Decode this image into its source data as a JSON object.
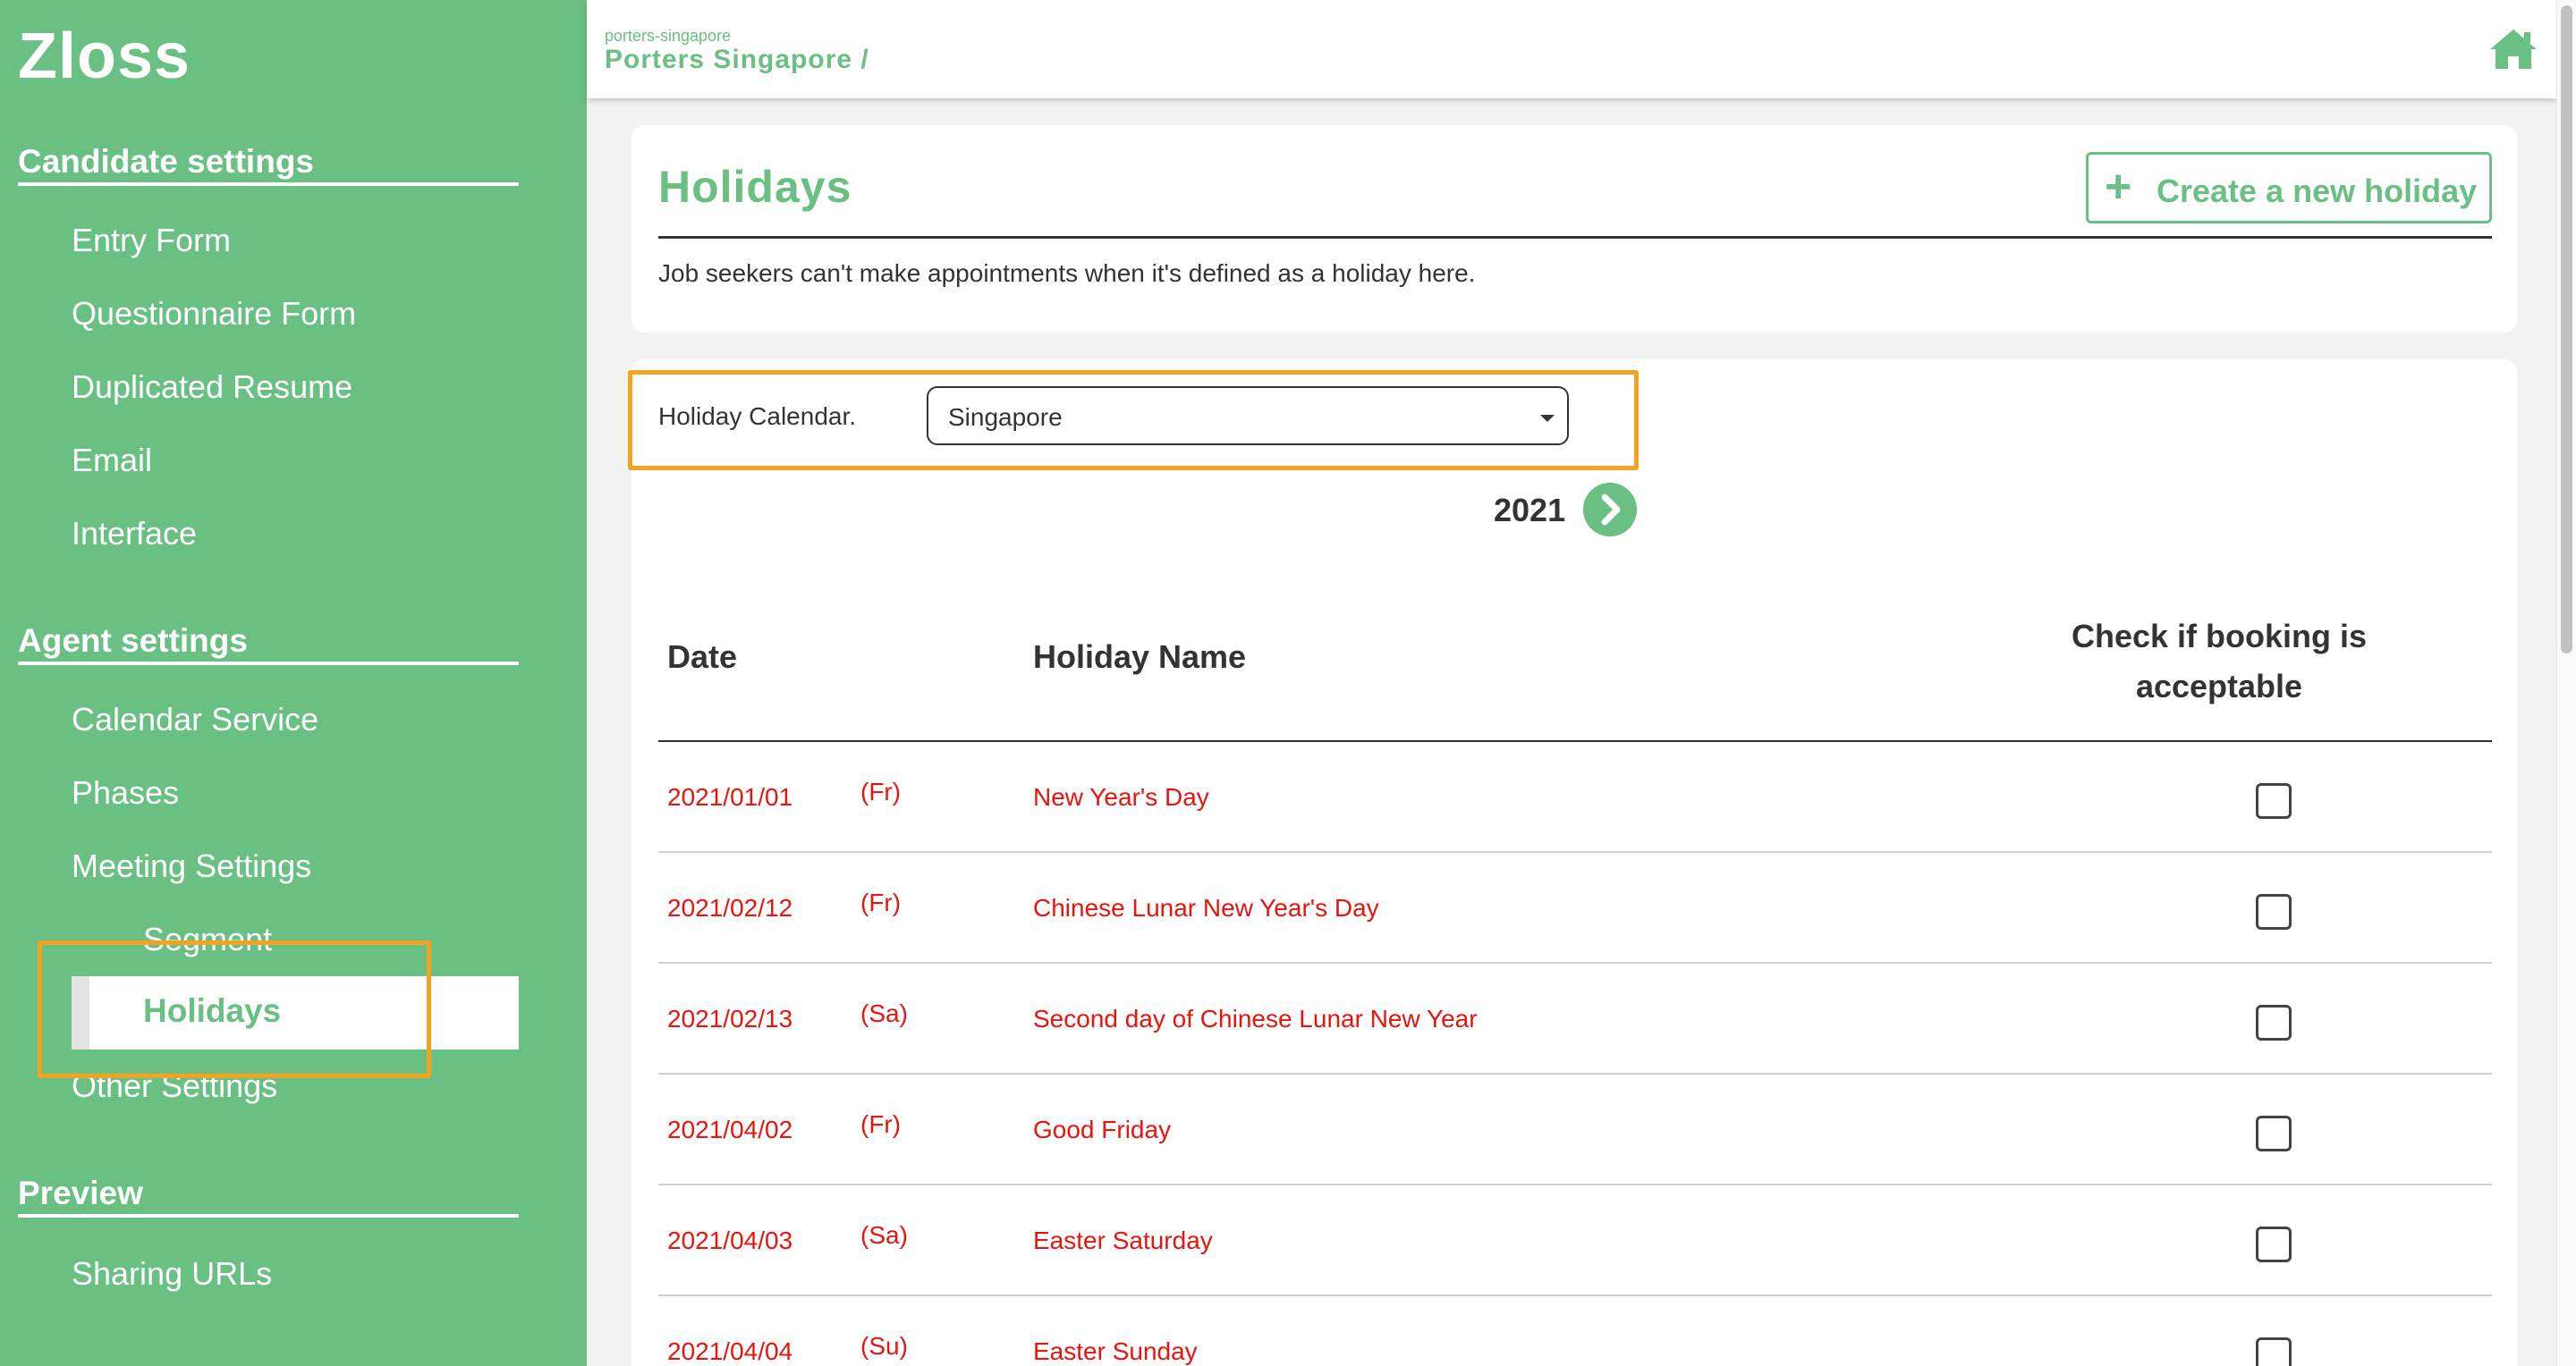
{
  "app": {
    "brand": "Zloss"
  },
  "colors": {
    "accent": "#6abf83",
    "holiday_text": "#e8140e",
    "highlight": "#f4a321"
  },
  "sidebar": {
    "sections": [
      {
        "title": "Candidate settings",
        "items": [
          "Entry Form",
          "Questionnaire Form",
          "Duplicated Resume",
          "Email",
          "Interface"
        ]
      },
      {
        "title": "Agent settings",
        "items": [
          "Calendar Service",
          "Phases",
          "Meeting Settings"
        ],
        "sub_items": [
          "Segment",
          "Holidays"
        ],
        "after_items": [
          "Other Settings"
        ]
      },
      {
        "title": "Preview",
        "items": [
          "Sharing URLs"
        ]
      }
    ],
    "active_item": "Holidays"
  },
  "header": {
    "org_slug": "porters-singapore",
    "org_name": "Porters Singapore /",
    "home_icon": "home-icon"
  },
  "page": {
    "title": "Holidays",
    "create_button": "Create a new holiday",
    "description": "Job seekers can't make appointments when it's defined as a holiday here."
  },
  "filter": {
    "label": "Holiday Calendar.",
    "selected": "Singapore"
  },
  "year": "2021",
  "table": {
    "headers": {
      "date": "Date",
      "name": "Holiday Name",
      "check_line1": "Check if booking is",
      "check_line2": "acceptable"
    },
    "rows": [
      {
        "date": "2021/01/01",
        "day": "(Fr)",
        "name": "New Year's Day",
        "checked": false
      },
      {
        "date": "2021/02/12",
        "day": "(Fr)",
        "name": "Chinese Lunar New Year's Day",
        "checked": false
      },
      {
        "date": "2021/02/13",
        "day": "(Sa)",
        "name": "Second day of Chinese Lunar New Year",
        "checked": false
      },
      {
        "date": "2021/04/02",
        "day": "(Fr)",
        "name": "Good Friday",
        "checked": false
      },
      {
        "date": "2021/04/03",
        "day": "(Sa)",
        "name": "Easter Saturday",
        "checked": false
      },
      {
        "date": "2021/04/04",
        "day": "(Su)",
        "name": "Easter Sunday",
        "checked": false
      }
    ]
  }
}
